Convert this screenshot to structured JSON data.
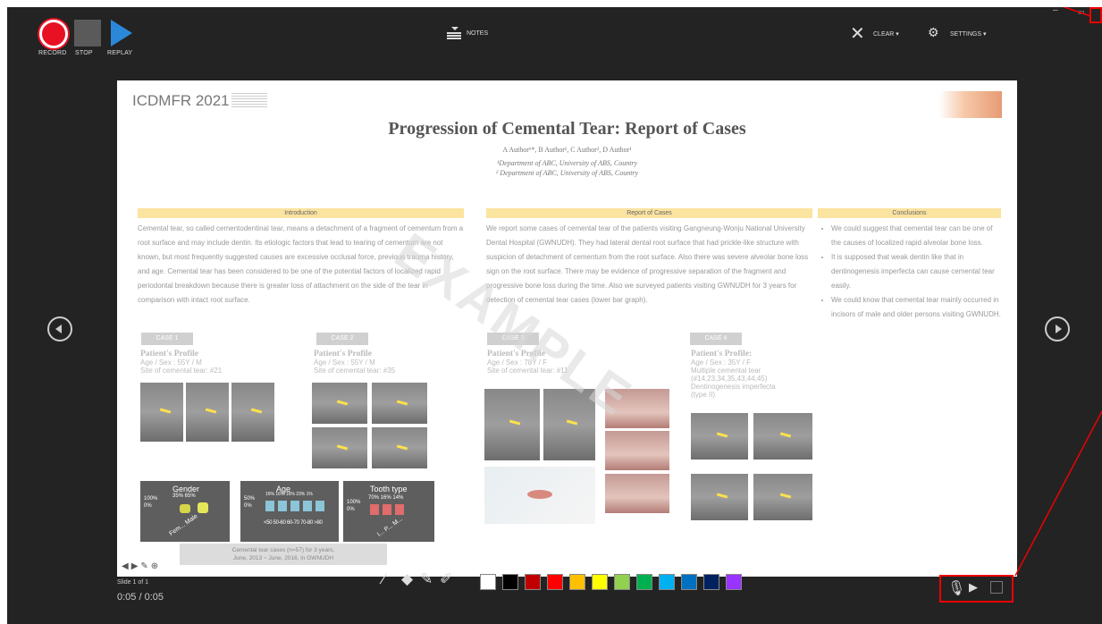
{
  "toolbar": {
    "record_label": "RECORD",
    "stop_label": "STOP",
    "replay_label": "REPLAY",
    "notes_label": "NOTES",
    "clear_label": "CLEAR ▾",
    "settings_label": "SETTINGS ▾",
    "colors": {
      "record": "#e81123",
      "replay": "#2b88d8"
    }
  },
  "slide": {
    "logo": "ICDMFR 2021",
    "title": "Progression of Cemental Tear: Report of Cases",
    "authors": "A Author¹*, B Author¹, C Author², D Author¹",
    "affil1": "¹Department of ABC, University of ABS, Country",
    "affil2": "² Department of ABC, University of ABS, Country",
    "watermark": "EXAMPLE",
    "introduction": {
      "heading": "Introduction",
      "text": "Cemental tear, so called cementodentinal tear, means a detachment of a fragment of cementum from a root surface and may include dentin. Its etiologic factors that lead to tearing of cementum are not known, but most frequently suggested causes are excessive occlusal force, previous trauma history, and age. Cemental tear has been considered to be one of the potential factors of localized rapid periodontal breakdown because there is greater loss of attachment on the side of the tear in comparison with intact root surface."
    },
    "report": {
      "heading": "Report of Cases",
      "text": "We report some cases of cemental tear of the patients visiting Gangneung-Wonju National University Dental Hospital (GWNUDH). They had lateral dental root surface that had prickle-like structure with suspicion of detachment of cementum from the root surface. Also there was severe alveolar bone loss sign on the root surface. There may be evidence of progressive separation of the fragment and progressive bone loss during the time. Also we surveyed patients visiting GWNUDH for 3 years for detection of cemental tear cases (lower bar graph)."
    },
    "conclusions": {
      "heading": "Conclusions",
      "items": [
        "We could suggest that cemental tear can be one of the causes of localized rapid alveolar bone loss.",
        "It is supposed that weak dentin like that in dentinogenesis imperfecta can cause cemental tear easily.",
        "We could know that cemental tear mainly occurred in incisors of male and older persons visiting GWNUDH."
      ]
    },
    "cases": [
      {
        "label": "CASE 1",
        "heading": "Patient's Profile",
        "detail": "Age / Sex : 55Y / M\nSite of cemental tear: #21"
      },
      {
        "label": "CASE 2",
        "heading": "Patient's Profile",
        "detail": "Age / Sex : 55Y / M\nSite of cemental tear: #35"
      },
      {
        "label": "CASE 3",
        "heading": "Patient's Profile",
        "detail": "Age / Sex : 78Y / F\nSite of cemental tear: #11"
      },
      {
        "label": "CASE 4",
        "heading": "Patient's Profile:",
        "detail": "Age / Sex : 35Y / F\nMultiple cemental tear\n(#14,23,34,35,43,44,45)\nDentinogenesis imperfecta\n(type II)"
      }
    ],
    "charts": [
      {
        "title": "Gender",
        "axis": "100%\n0%",
        "cats": "Fem...  Male",
        "vals": "35%  65%"
      },
      {
        "title": "Age",
        "axis": "50%\n0%",
        "cats": "<50 50-60 60-70 70-80 >80",
        "vals": "16% 16% 16% 23% 1%"
      },
      {
        "title": "Tooth type",
        "axis": "100%\n0%",
        "cats": "I... P... M...",
        "vals": "70% 16% 14%"
      }
    ],
    "caption": "Cemental tear cases (n=57) for 3 years,\nJune, 2013 ~ June, 2016, in GWNUDH"
  },
  "status": {
    "slide_counter": "Slide 1 of 1",
    "timer": "0:05 / 0:05"
  },
  "palette": [
    "#ffffff",
    "#000000",
    "#c00000",
    "#ff0000",
    "#ffc000",
    "#ffff00",
    "#92d050",
    "#00b050",
    "#00b0f0",
    "#0070c0",
    "#002060",
    "#9933ff"
  ]
}
